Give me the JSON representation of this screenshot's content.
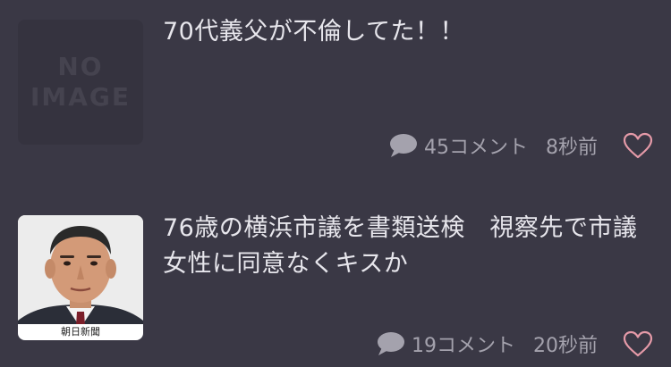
{
  "articles": [
    {
      "title": "70代義父が不倫してた！！",
      "thumbnail": {
        "type": "placeholder",
        "placeholder_lines": [
          "NO",
          "IMAGE"
        ]
      },
      "comments": "45コメント",
      "time": "8秒前"
    },
    {
      "title": "76歳の横浜市議を書類送検　視察先で市議女性に同意なくキスか",
      "thumbnail": {
        "type": "photo",
        "credit": "朝日新聞"
      },
      "comments": "19コメント",
      "time": "20秒前"
    }
  ],
  "colors": {
    "background": "#3a3845",
    "title_text": "#e7e6ec",
    "meta_text": "#a4a2ad",
    "heart_outline": "#e59aa8"
  }
}
